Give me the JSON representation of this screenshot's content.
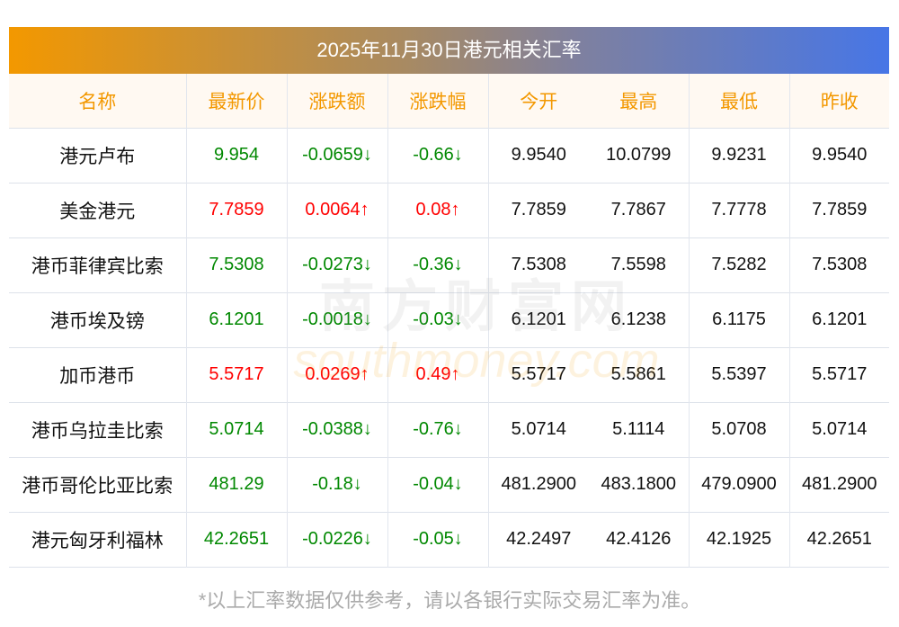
{
  "title": "2025年11月30日港元相关汇率",
  "headers": [
    "名称",
    "最新价",
    "涨跌额",
    "涨跌幅",
    "今开",
    "最高",
    "最低",
    "昨收"
  ],
  "rows": [
    {
      "name": "港元卢布",
      "latest": "9.954",
      "change": "-0.0659↓",
      "pct": "-0.66↓",
      "dir": "down",
      "open": "9.9540",
      "high": "10.0799",
      "low": "9.9231",
      "prev": "9.9540"
    },
    {
      "name": "美金港元",
      "latest": "7.7859",
      "change": "0.0064↑",
      "pct": "0.08↑",
      "dir": "up",
      "open": "7.7859",
      "high": "7.7867",
      "low": "7.7778",
      "prev": "7.7859"
    },
    {
      "name": "港币菲律宾比索",
      "latest": "7.5308",
      "change": "-0.0273↓",
      "pct": "-0.36↓",
      "dir": "down",
      "open": "7.5308",
      "high": "7.5598",
      "low": "7.5282",
      "prev": "7.5308"
    },
    {
      "name": "港币埃及镑",
      "latest": "6.1201",
      "change": "-0.0018↓",
      "pct": "-0.03↓",
      "dir": "down",
      "open": "6.1201",
      "high": "6.1238",
      "low": "6.1175",
      "prev": "6.1201"
    },
    {
      "name": "加币港币",
      "latest": "5.5717",
      "change": "0.0269↑",
      "pct": "0.49↑",
      "dir": "up",
      "open": "5.5717",
      "high": "5.5861",
      "low": "5.5397",
      "prev": "5.5717"
    },
    {
      "name": "港币乌拉圭比索",
      "latest": "5.0714",
      "change": "-0.0388↓",
      "pct": "-0.76↓",
      "dir": "down",
      "open": "5.0714",
      "high": "5.1114",
      "low": "5.0708",
      "prev": "5.0714"
    },
    {
      "name": "港币哥伦比亚比索",
      "latest": "481.29",
      "change": "-0.18↓",
      "pct": "-0.04↓",
      "dir": "down",
      "open": "481.2900",
      "high": "483.1800",
      "low": "479.0900",
      "prev": "481.2900"
    },
    {
      "name": "港元匈牙利福林",
      "latest": "42.2651",
      "change": "-0.0226↓",
      "pct": "-0.05↓",
      "dir": "down",
      "open": "42.2497",
      "high": "42.4126",
      "low": "42.1925",
      "prev": "42.2651"
    }
  ],
  "watermark": {
    "cn": "南方财富网",
    "en": "southmoney.com"
  },
  "footer": "*以上汇率数据仅供参考，请以各银行实际交易汇率为准。"
}
